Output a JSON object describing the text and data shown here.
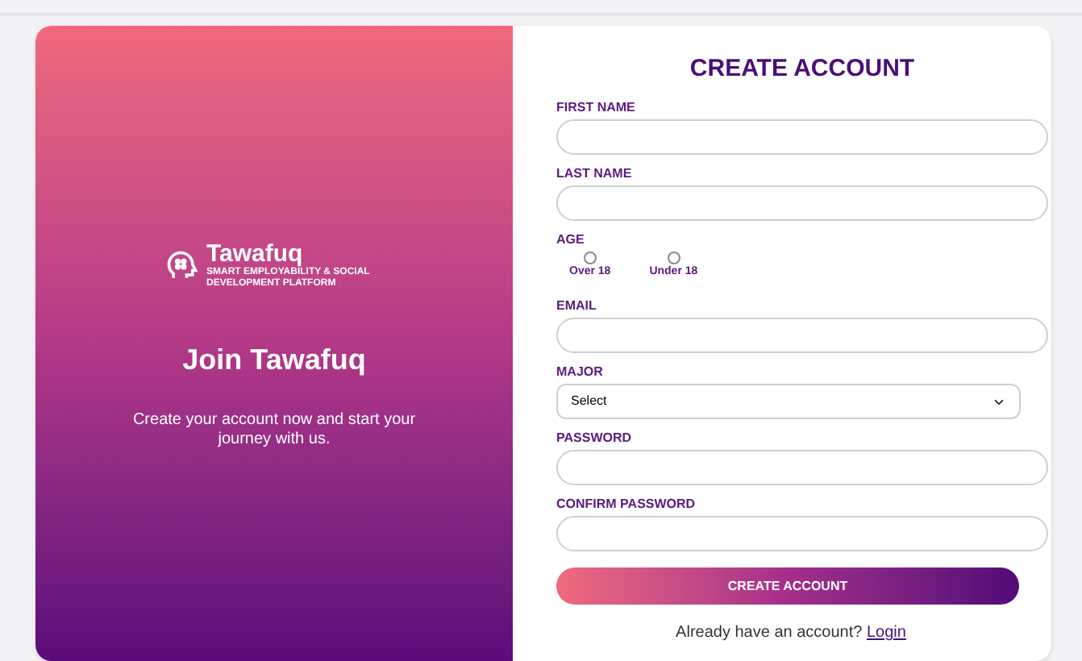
{
  "brand": {
    "name": "Tawafuq",
    "tagline": "SMART EMPLOYABILITY & SOCIAL DEVELOPMENT PLATFORM"
  },
  "intro": {
    "title": "Join Tawafuq",
    "text": "Create your account now and start your journey with us."
  },
  "form": {
    "title": "CREATE ACCOUNT",
    "fields": [
      {
        "kind": "text",
        "label": "FIRST NAME"
      },
      {
        "kind": "text",
        "label": "LAST NAME"
      },
      {
        "kind": "radio",
        "label": "AGE",
        "options": [
          {
            "label": "Over 18",
            "selected": false
          },
          {
            "label": "Under 18",
            "selected": false
          }
        ]
      },
      {
        "kind": "text",
        "label": "EMAIL"
      },
      {
        "kind": "select",
        "label": "MAJOR",
        "value": "Select"
      },
      {
        "kind": "text",
        "label": "PASSWORD"
      },
      {
        "kind": "text",
        "label": "CONFIRM PASSWORD"
      }
    ],
    "submit": "CREATE ACCOUNT",
    "footer": "Already have an account?",
    "login": "Login"
  }
}
